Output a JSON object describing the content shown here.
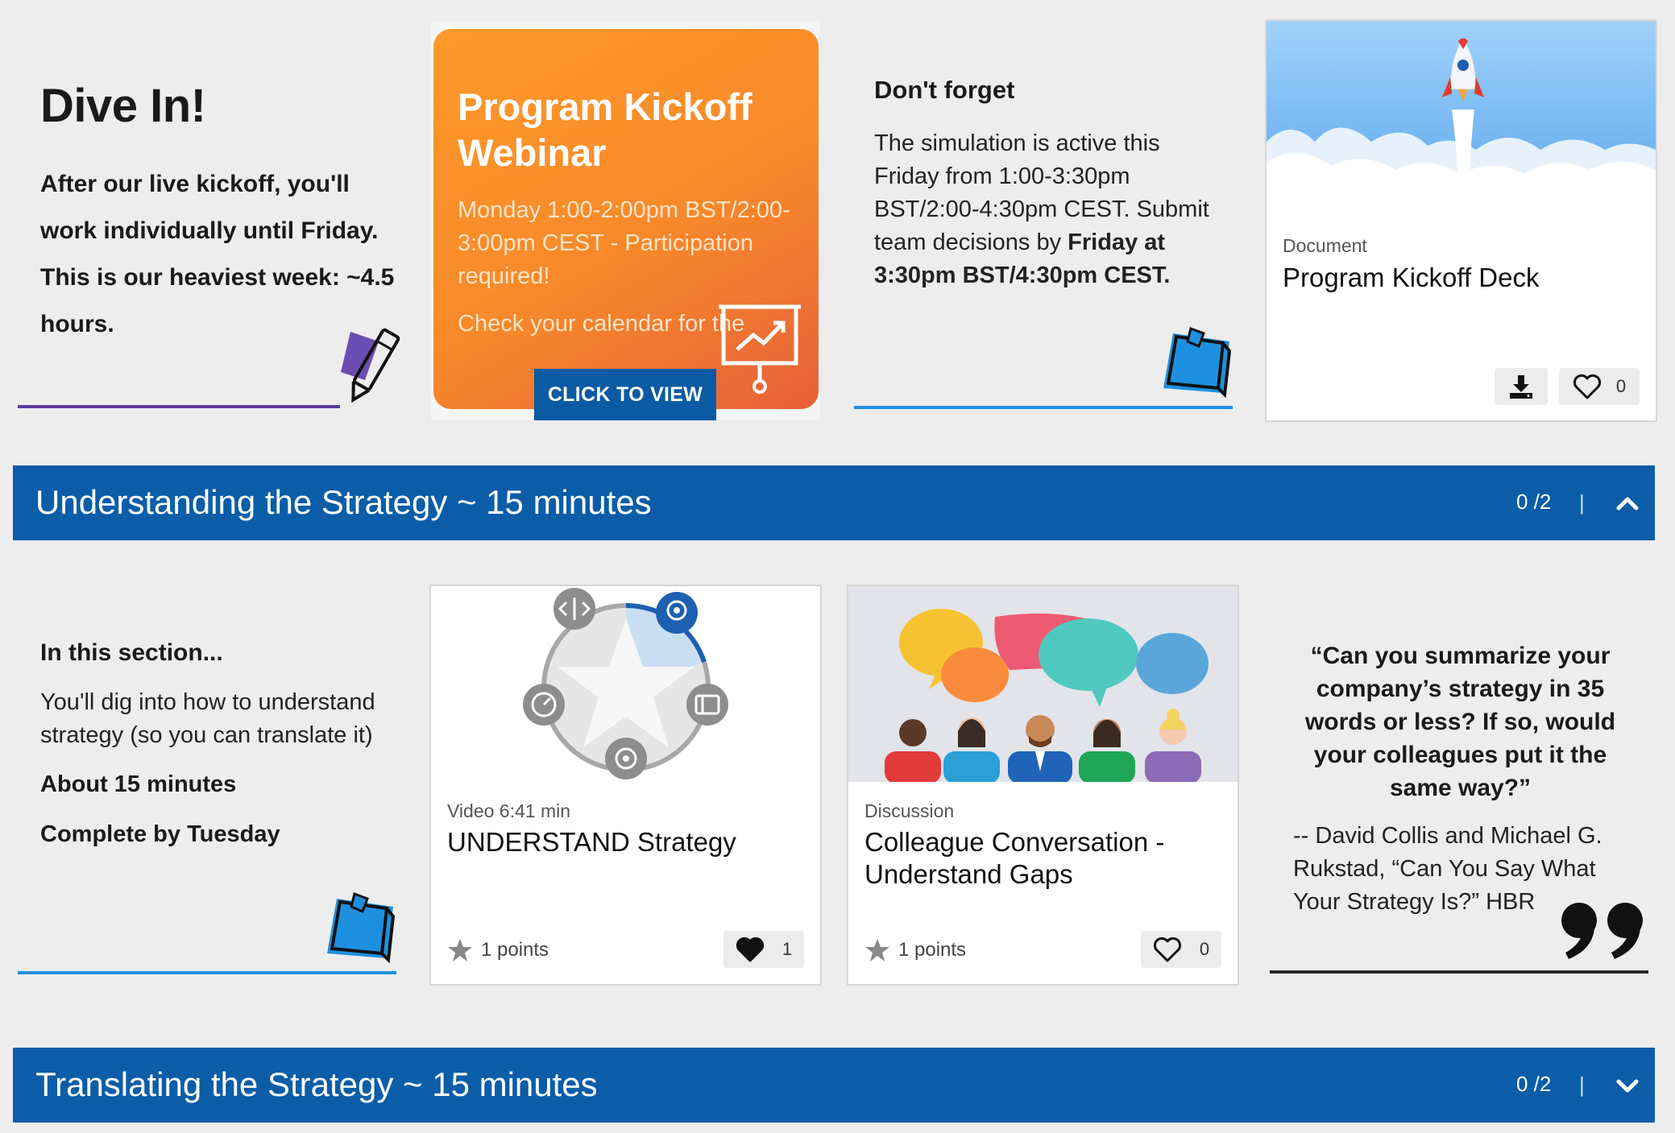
{
  "intro": {
    "title": "Dive In!",
    "body": "After our live kickoff, you'll work individually until Friday. This is our heaviest week:  ~4.5 hours."
  },
  "webinar": {
    "title": "Program Kickoff Webinar",
    "time": "Monday 1:00-2:00pm BST/2:00-3:00pm CEST - Participation required!",
    "check": "Check your calendar for the",
    "cta": "CLICK TO VIEW"
  },
  "reminder": {
    "title": "Don't forget",
    "body_part1": "The simulation is active this Friday from 1:00-3:30pm BST/2:00-4:30pm CEST. Submit team decisions by ",
    "body_bold": "Friday at 3:30pm BST/4:30pm CEST."
  },
  "deck": {
    "type": "Document",
    "title": "Program Kickoff Deck",
    "likes": "0"
  },
  "sections": [
    {
      "title": "Understanding the Strategy ~ 15 minutes",
      "progress": "0 /2",
      "separator": "|",
      "expanded": true
    },
    {
      "title": "Translating the Strategy ~ 15 minutes",
      "progress": "0 /2",
      "separator": "|",
      "expanded": false
    }
  ],
  "section_intro": {
    "heading": "In this section...",
    "description": "You'll dig into how to understand strategy (so you can translate it)",
    "duration": "About 15 minutes",
    "deadline": "Complete by Tuesday"
  },
  "cards": [
    {
      "type": "Video 6:41 min",
      "title": "UNDERSTAND Strategy",
      "points": "1 points",
      "likes": "1",
      "liked": true
    },
    {
      "type": "Discussion",
      "title": "Colleague Conversation - Understand Gaps",
      "points": "1 points",
      "likes": "0",
      "liked": false
    }
  ],
  "quote": {
    "text": "“Can you summarize your company’s strategy in 35 words or less? If so, would your colleagues put it the same way?”",
    "attribution": "-- David Collis and Michael G. Rukstad, “Can You Say What Your Strategy Is?” HBR"
  },
  "colors": {
    "section_bar": "#0b5da8",
    "cta": "#0b5aa3",
    "webinar_orange": "#f7892a",
    "purple_line": "#5b3b9e",
    "blue_line": "#1e90e0"
  },
  "icons": [
    "pen-icon",
    "sticky-note-icon",
    "presentation-chart-icon",
    "download-icon",
    "heart-icon",
    "star-icon",
    "chevron-up-icon",
    "chevron-down-icon",
    "quote-mark-icon"
  ]
}
